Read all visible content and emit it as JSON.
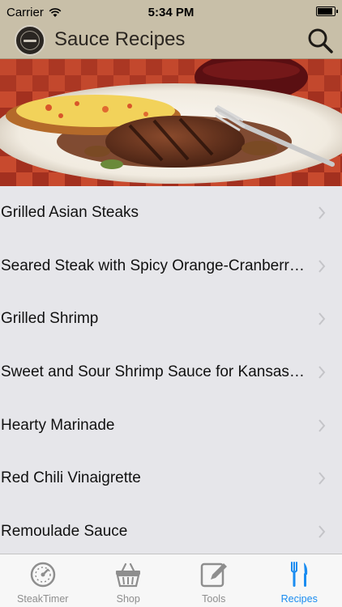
{
  "status_bar": {
    "carrier": "Carrier",
    "time": "5:34 PM"
  },
  "nav": {
    "title": "Sauce Recipes"
  },
  "recipes": [
    "Grilled Asian Steaks",
    "Seared Steak with Spicy Orange-Cranberry Sauce",
    "Grilled Shrimp",
    "Sweet and Sour Shrimp Sauce for Kansas City Steaks",
    "Hearty Marinade",
    "Red Chili Vinaigrette",
    "Remoulade Sauce"
  ],
  "tabs": [
    {
      "label": "SteakTimer",
      "icon": "gauge-icon",
      "active": false
    },
    {
      "label": "Shop",
      "icon": "basket-icon",
      "active": false
    },
    {
      "label": "Tools",
      "icon": "edit-icon",
      "active": false
    },
    {
      "label": "Recipes",
      "icon": "fork-knife-icon",
      "active": true
    }
  ],
  "colors": {
    "bar": "#c8bfa8",
    "accent": "#1a8cf0",
    "list_bg": "#e6e6ea"
  }
}
